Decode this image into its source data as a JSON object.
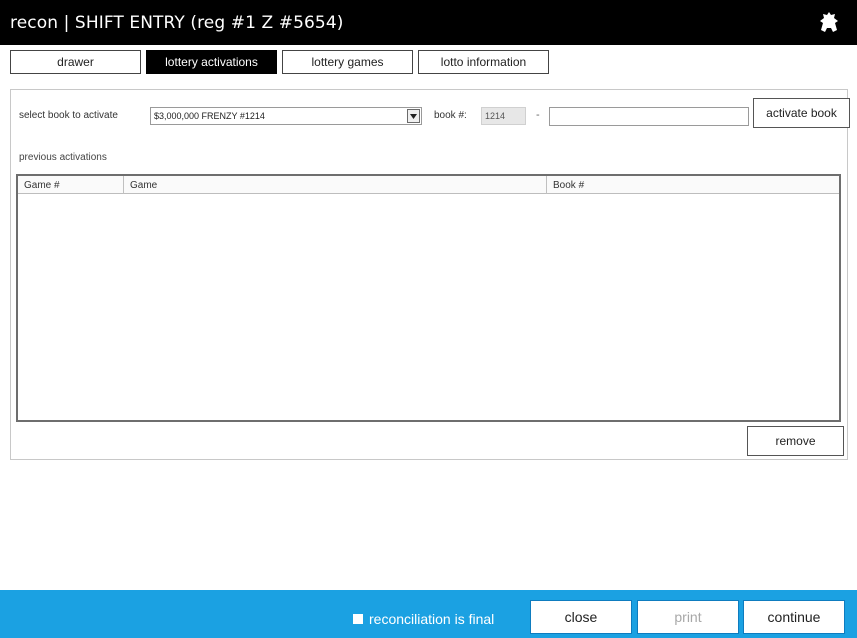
{
  "window": {
    "title": "recon | SHIFT ENTRY  (reg #1  Z #5654)"
  },
  "tabs": [
    {
      "label": "drawer",
      "active": false
    },
    {
      "label": "lottery activations",
      "active": true
    },
    {
      "label": "lottery games",
      "active": false
    },
    {
      "label": "lotto information",
      "active": false
    }
  ],
  "activation": {
    "select_label": "select book to activate",
    "selected_book": "$3,000,000 FRENZY #1214",
    "book_label": "book #:",
    "book_number": "1214",
    "separator": "-",
    "book_suffix": "",
    "activate_label": "activate book"
  },
  "previous": {
    "label": "previous activations",
    "columns": [
      "Game #",
      "Game",
      "Book #"
    ],
    "rows": []
  },
  "remove_label": "remove",
  "footer": {
    "final_label": "reconciliation is final",
    "final_checked": false,
    "close_label": "close",
    "print_label": "print",
    "continue_label": "continue"
  },
  "colors": {
    "titlebar": "#000000",
    "footer": "#1ba1e2",
    "active_tab": "#000000"
  },
  "icons": {
    "logo": "alien-logo-icon",
    "dropdown": "dropdown-arrow-icon"
  }
}
